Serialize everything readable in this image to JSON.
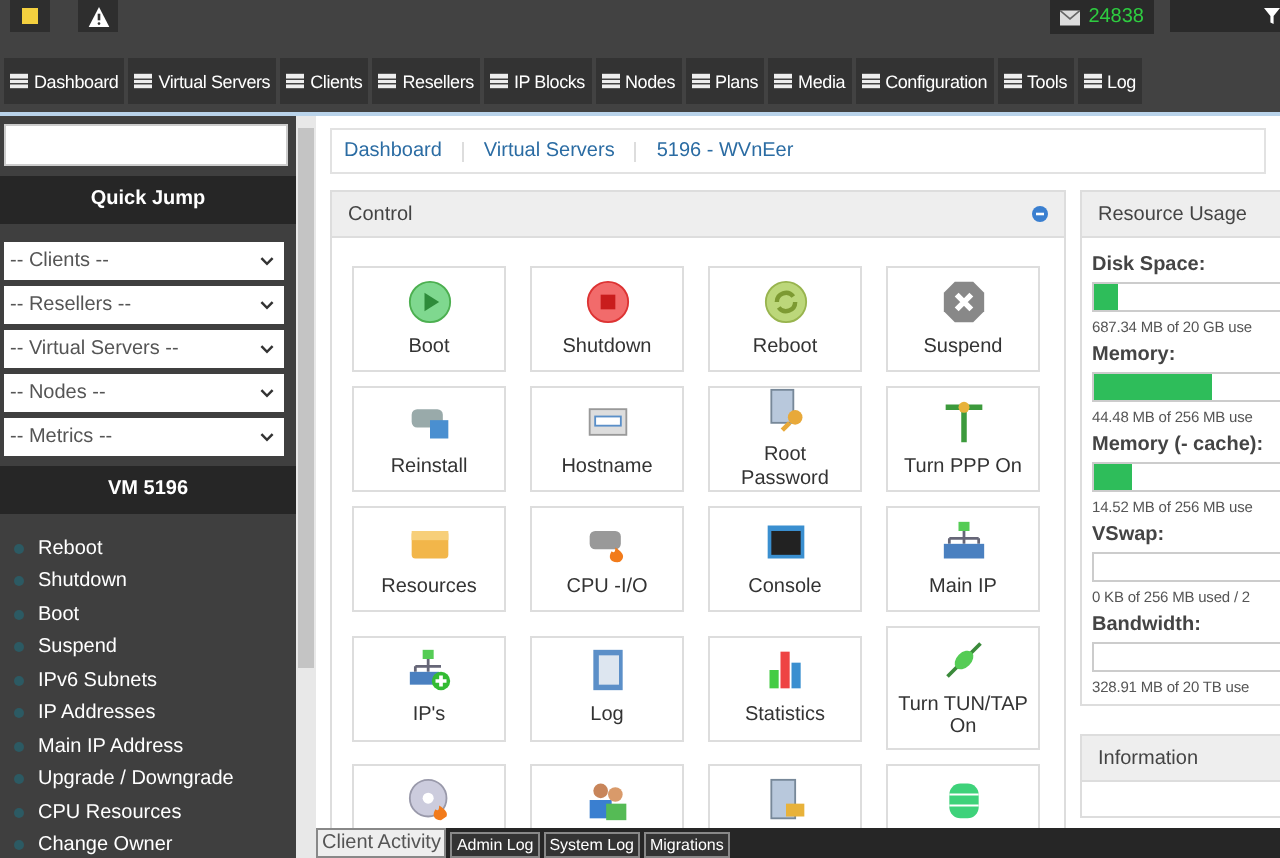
{
  "top_bar": {
    "mail_count": "24838"
  },
  "nav_tabs": [
    {
      "label": "Dashboard"
    },
    {
      "label": "Virtual Servers"
    },
    {
      "label": "Clients"
    },
    {
      "label": "Resellers"
    },
    {
      "label": "IP Blocks"
    },
    {
      "label": "Nodes"
    },
    {
      "label": "Plans"
    },
    {
      "label": "Media"
    },
    {
      "label": "Configuration"
    },
    {
      "label": "Tools"
    },
    {
      "label": "Log"
    }
  ],
  "sidebar": {
    "quick_jump_title": "Quick Jump",
    "selects": [
      "-- Clients --",
      "-- Resellers --",
      "-- Virtual Servers --",
      "-- Nodes --",
      "-- Metrics --"
    ],
    "vm_title": "VM 5196",
    "items": [
      "Reboot",
      "Shutdown",
      "Boot",
      "Suspend",
      "IPv6 Subnets",
      "IP Addresses",
      "Main IP Address",
      "Upgrade / Downgrade",
      "CPU Resources",
      "Change Owner"
    ]
  },
  "breadcrumb": [
    "Dashboard",
    "Virtual Servers",
    "5196 - WVnEer"
  ],
  "control": {
    "title": "Control",
    "tiles": [
      "Boot",
      "Shutdown",
      "Reboot",
      "Suspend",
      "Reinstall",
      "Hostname",
      "Root Password",
      "Turn PPP On",
      "Resources",
      "CPU -I/O",
      "Console",
      "Main IP",
      "IP's",
      "Log",
      "Statistics",
      "Turn TUN/TAP On"
    ]
  },
  "resource_usage": {
    "title": "Resource Usage",
    "meters": [
      {
        "label": "Disk Space:",
        "level": 0.034,
        "reading": "687.34 MB of 20 GB use"
      },
      {
        "label": "Memory:",
        "level": 0.174,
        "reading": "44.48 MB of 256 MB use"
      },
      {
        "label": "Memory (- cache):",
        "level": 0.057,
        "reading": "14.52 MB of 256 MB use"
      },
      {
        "label": "VSwap:",
        "level": 0,
        "reading": "0 KB of 256 MB used / 2"
      },
      {
        "label": "Bandwidth:",
        "level": 2e-05,
        "reading": "328.91 MB of 20 TB use"
      }
    ]
  },
  "information": {
    "title": "Information"
  },
  "bottom_tabs": [
    {
      "label": "Client Activity",
      "selected": true
    },
    {
      "label": "Admin Log",
      "selected": false
    },
    {
      "label": "System Log",
      "selected": false
    },
    {
      "label": "Migrations",
      "selected": false
    }
  ]
}
